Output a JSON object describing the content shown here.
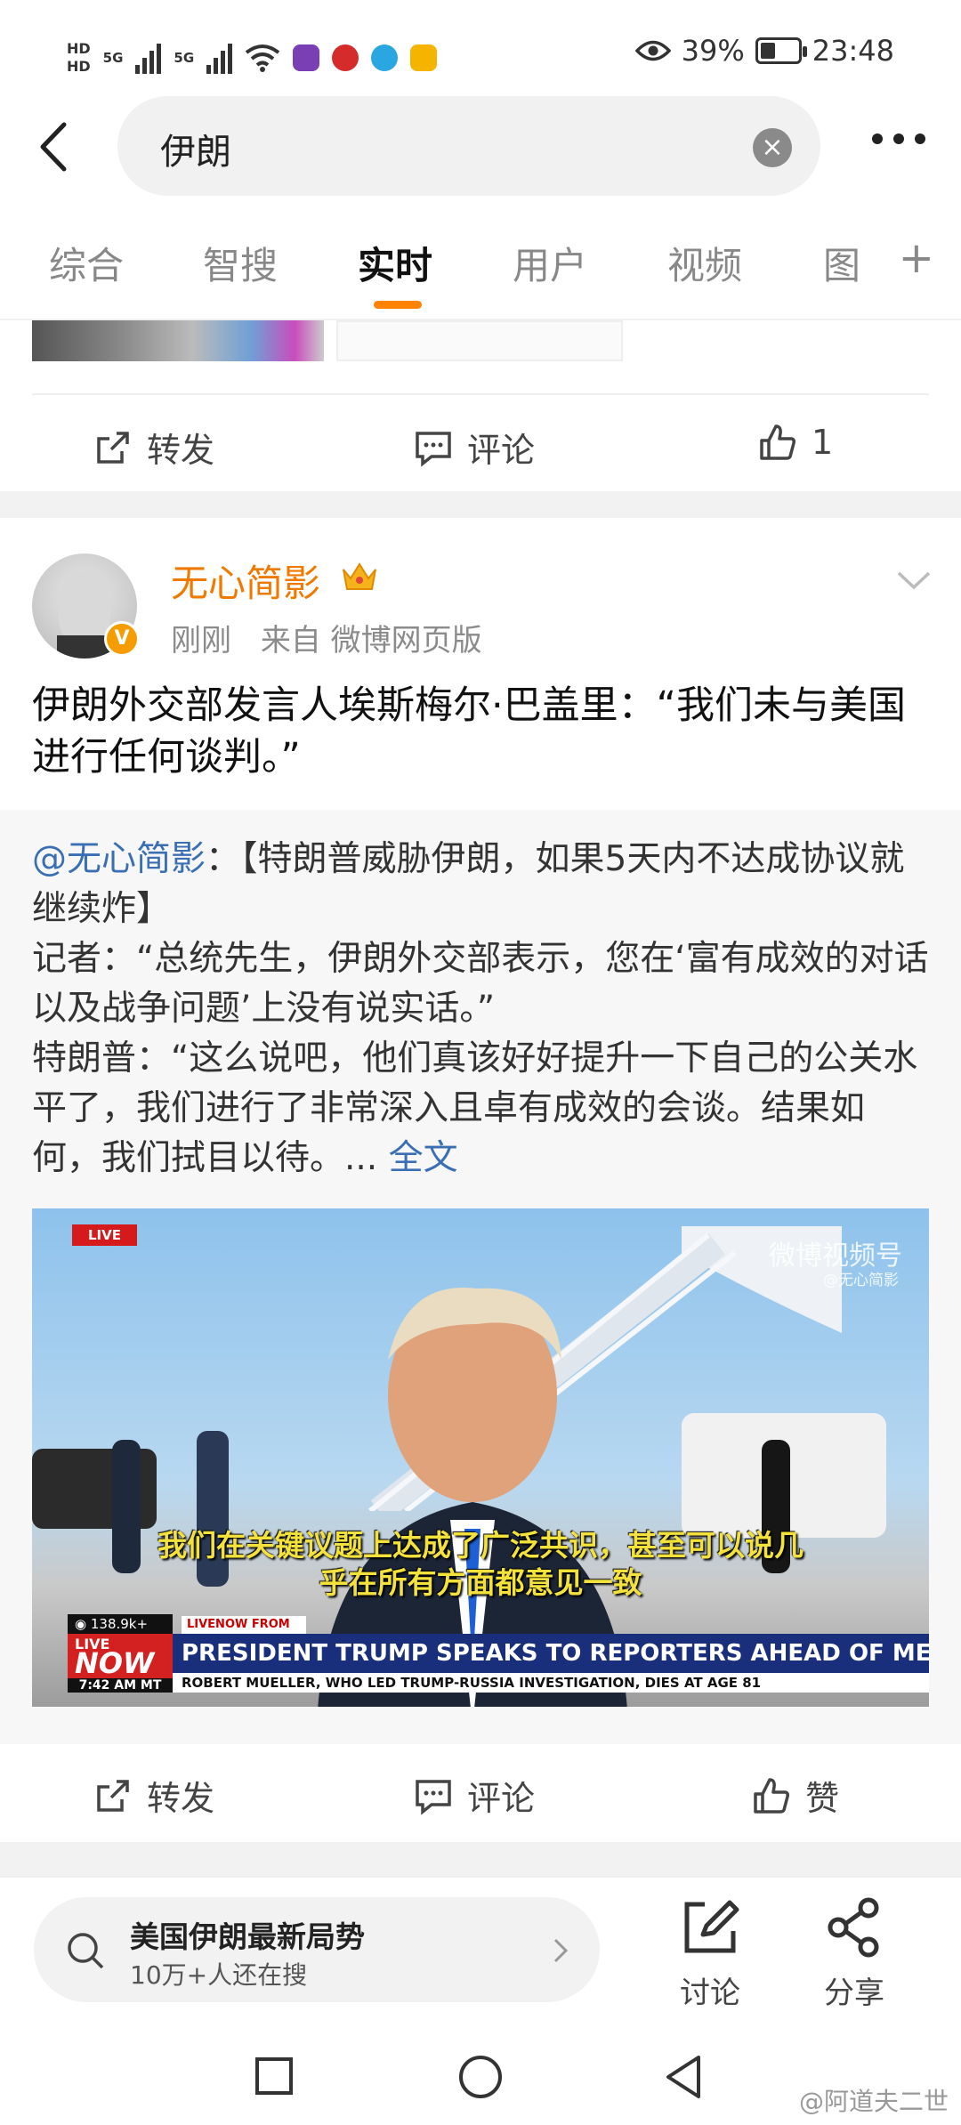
{
  "status_bar": {
    "hd1": "HD",
    "hd2": "HD",
    "net1": "5G",
    "net2": "5G",
    "battery_percent": "39%",
    "battery_level": 0.39,
    "time": "23:48"
  },
  "header": {
    "query": "伊朗",
    "clear_icon": "clear-icon",
    "more_icon": "more-icon"
  },
  "tabs": [
    {
      "label": "综合",
      "active": false
    },
    {
      "label": "智搜",
      "active": false
    },
    {
      "label": "实时",
      "active": true
    },
    {
      "label": "用户",
      "active": false
    },
    {
      "label": "视频",
      "active": false
    },
    {
      "label": "图",
      "active": false
    }
  ],
  "tabs_plus": "+",
  "prev_post_actions": {
    "repost": "转发",
    "comment": "评论",
    "like_count": "1"
  },
  "post": {
    "author": "无心简影",
    "verified_badge": "V",
    "time": "刚刚",
    "source": "来自 微博网页版",
    "text": "伊朗外交部发言人埃斯梅尔·巴盖里：“我们未与美国进行任何谈判。”",
    "quote": {
      "mention": "@无心简影",
      "body": "：【特朗普威胁伊朗，如果5天内不达成协议就继续炸】\n记者：“总统先生，伊朗外交部表示，您在‘富有成效的对话以及战争问题’上没有说实话。”\n特朗普：“这么说吧，他们真该好好提升一下自己的公关水平了，我们进行了非常深入且卓有成效的会谈。结果如何，我们拭目以待。...",
      "full_text_link": "全文"
    },
    "video": {
      "live_tag": "LIVE",
      "watermark": "微博视频号",
      "watermark_sub": "@无心简影",
      "caption_line1": "我们在关键议题上达成了广泛共识，甚至可以说几",
      "caption_line2": "乎在所有方面都意见一致",
      "views": "138.9k+",
      "livenow_from": "LIVENOW FROM FOX",
      "now_live": "LIVE",
      "now": "NOW",
      "now_time": "7:42 AM MT",
      "headline": "PRESIDENT TRUMP SPEAKS TO REPORTERS AHEAD OF MEMPHIS TRIP",
      "ticker": "ROBERT MUELLER, WHO LED TRUMP-RUSSIA INVESTIGATION, DIES AT AGE 81"
    },
    "actions": {
      "repost": "转发",
      "comment": "评论",
      "like": "赞"
    }
  },
  "bottom_bar": {
    "hot_title": "美国伊朗最新局势",
    "hot_sub": "10万+人还在搜",
    "discuss": "讨论",
    "share": "分享"
  },
  "credit": "@阿道夫二世"
}
